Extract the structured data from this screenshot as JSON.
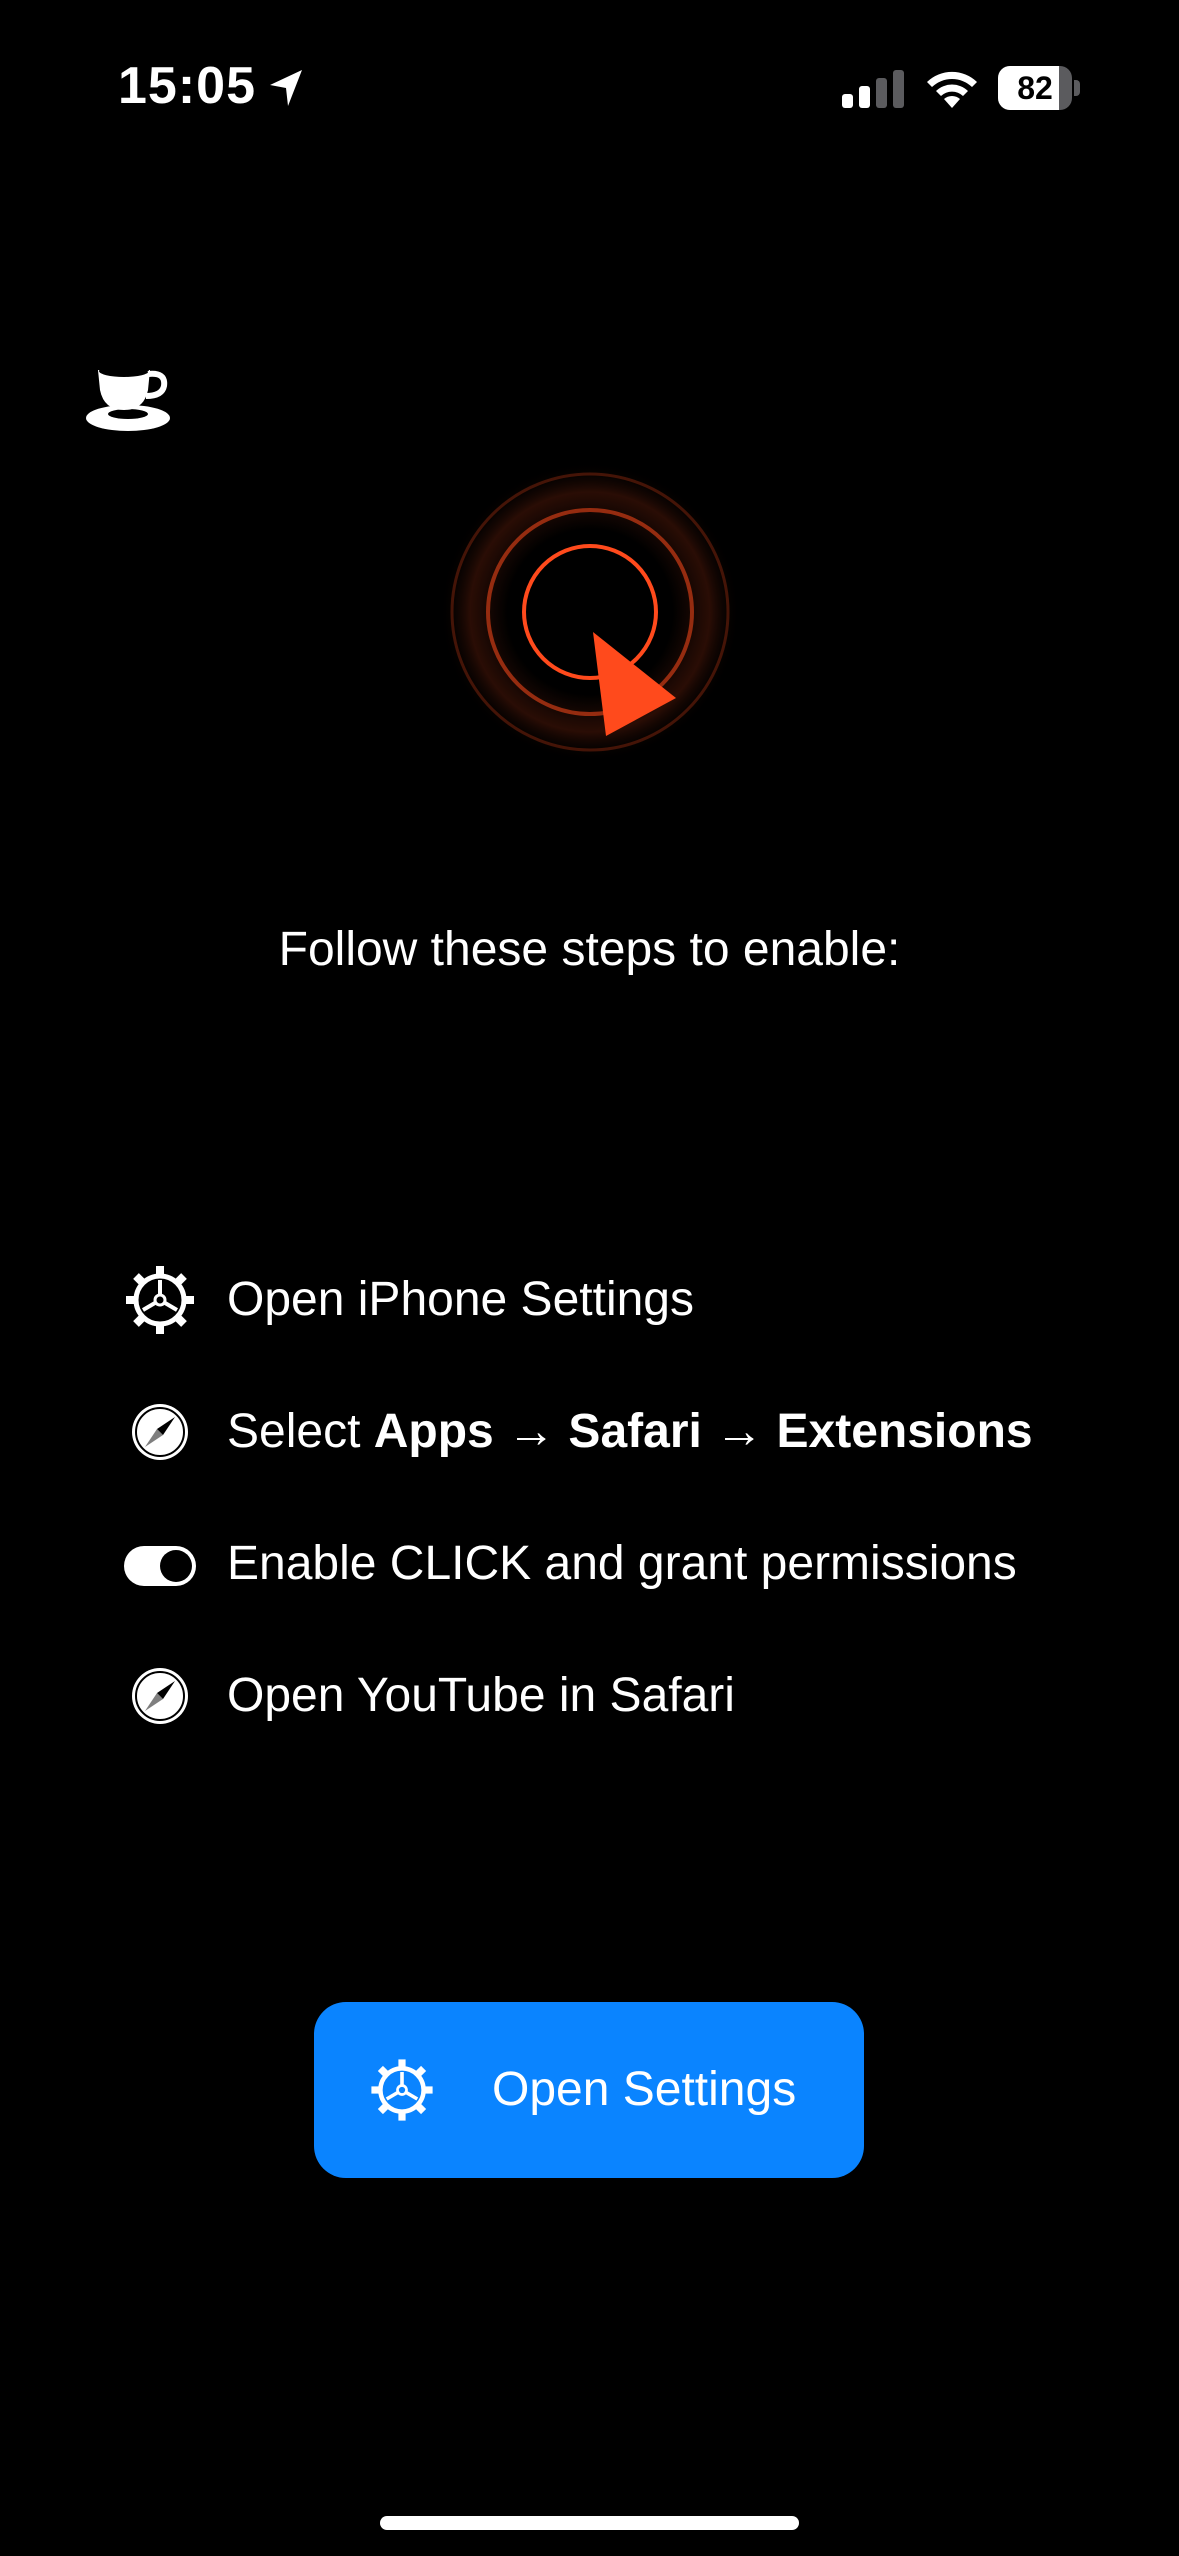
{
  "status_bar": {
    "time": "15:05",
    "battery_percent": "82",
    "battery_level": 0.82,
    "icons": [
      "location-arrow-icon",
      "cellular-signal-icon",
      "wifi-icon",
      "battery-icon"
    ]
  },
  "header": {
    "icon": "coffee-cup-icon"
  },
  "hero": {
    "logo": "click-target-logo",
    "accent_color": "#ff4a1c"
  },
  "instructions": {
    "title": "Follow these steps to enable:",
    "steps": [
      {
        "icon": "gear-icon",
        "text": "Open iPhone Settings"
      },
      {
        "icon": "safari-compass-icon",
        "prefix": "Select ",
        "apps": "Apps",
        "arrow1": " → ",
        "safari": "Safari",
        "arrow2": " → ",
        "extensions": "Extensions"
      },
      {
        "icon": "toggle-switch-icon",
        "text": "Enable CLICK and grant permissions"
      },
      {
        "icon": "safari-compass-icon",
        "text": "Open YouTube in Safari"
      }
    ]
  },
  "actions": {
    "open_settings_label": "Open Settings",
    "open_settings_icon": "gear-icon",
    "button_color": "#0a84ff"
  }
}
